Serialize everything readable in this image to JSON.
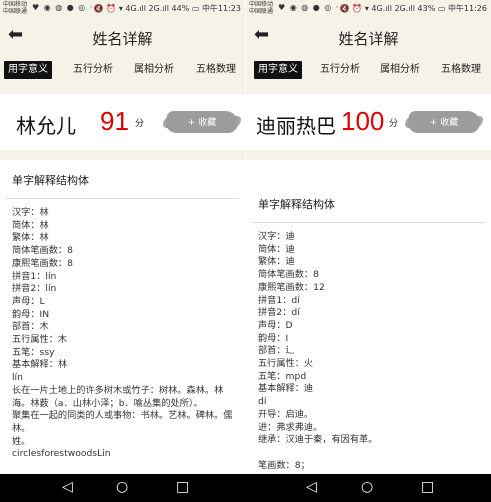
{
  "left": {
    "status": {
      "carrier1": "中国移动",
      "carrier2": "中国联通",
      "icons_left": "♥ ◉ ◍ ● ◎ ···",
      "icons_right": "🔇 ⏰ ▾ 4G.ıll 2G.ıll 44% ▭ 中午11:23"
    },
    "title": "姓名详解",
    "tabs": [
      "用字意义",
      "五行分析",
      "属相分析",
      "五格数理"
    ],
    "name": "林允儿",
    "score": "91",
    "score_unit": "分",
    "fav_label": "+ 收藏",
    "section_title": "单字解释结构体",
    "lines": [
      "汉字：林",
      "简体：林",
      "繁体：林",
      "简体笔画数：8",
      "康熙笔画数：8",
      "拼音1：lín",
      "拼音2：lín",
      "声母：L",
      "韵母：IN",
      "部首：木",
      "五行属性：木",
      "五笔：ssy",
      "基本解释：林",
      "lín",
      "长在一片土地上的许多树木或竹子：树林。森林。林海。林薮（a．山林小泽；b．喻丛集的处所）。",
      "聚集在一起的同类的人或事物：书林。艺林。碑林。儒林。",
      "姓。",
      "circlesforestwoodsLin"
    ]
  },
  "right": {
    "status": {
      "carrier1": "中国移动",
      "carrier2": "中国联通",
      "icons_left": "♥ ◉ ◍ ● ◎ ···",
      "icons_right": "🔇 ⏰ ▾ 4G.ıll 2G.ıll 43% ▭ 中午11:26"
    },
    "title": "姓名详解",
    "tabs": [
      "用字意义",
      "五行分析",
      "属相分析",
      "五格数理"
    ],
    "name": "迪丽热巴",
    "score": "100",
    "score_unit": "分",
    "fav_label": "+ 收藏",
    "section_title": "单字解释结构体",
    "lines": [
      "汉字：迪",
      "简体：迪",
      "繁体：迪",
      "简体笔画数：8",
      "康熙笔画数：12",
      "拼音1：dí",
      "拼音2：dí",
      "声母：D",
      "韵母：I",
      "部首：辶",
      "五行属性：火",
      "五笔：mpd",
      "基本解释：迪",
      "dí",
      "开导：启迪。",
      "进：弗求弗迪。",
      "继承：汉迪于秦，有因有革。",
      "",
      "笔画数：8；"
    ]
  },
  "navbar": {
    "back": "◁",
    "home": "○",
    "recent": "□"
  }
}
